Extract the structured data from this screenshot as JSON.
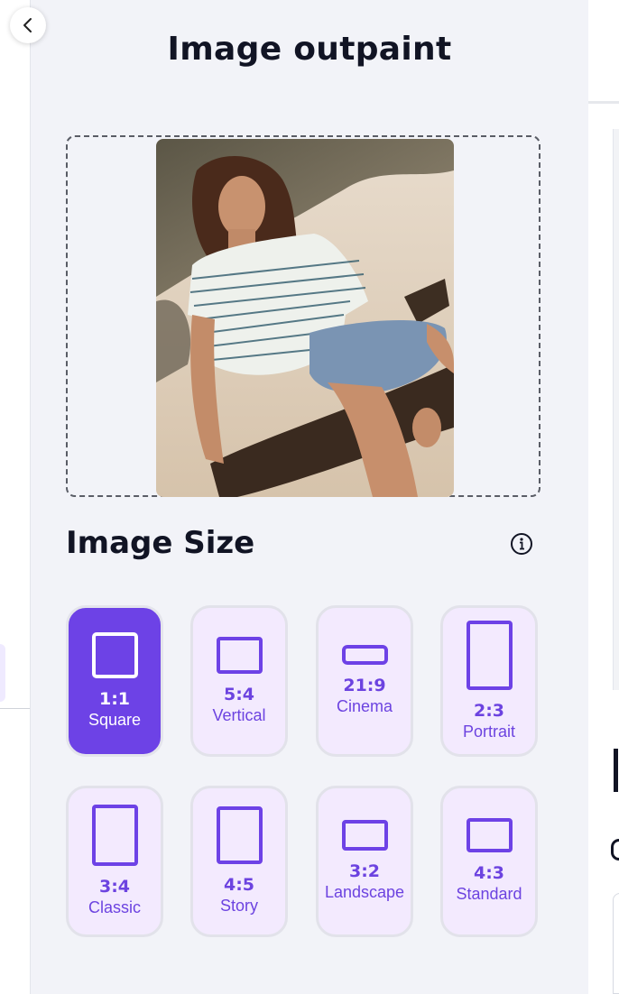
{
  "title": "Image outpaint",
  "image_size": {
    "heading": "Image Size",
    "options": [
      {
        "ratio": "1:1",
        "label": "Square",
        "selected": true
      },
      {
        "ratio": "5:4",
        "label": "Vertical",
        "selected": false
      },
      {
        "ratio": "21:9",
        "label": "Cinema",
        "selected": false
      },
      {
        "ratio": "2:3",
        "label": "Portrait",
        "selected": false
      },
      {
        "ratio": "3:4",
        "label": "Classic",
        "selected": false
      },
      {
        "ratio": "4:5",
        "label": "Story",
        "selected": false
      },
      {
        "ratio": "3:2",
        "label": "Landscape",
        "selected": false
      },
      {
        "ratio": "4:3",
        "label": "Standard",
        "selected": false
      }
    ]
  },
  "icons": {
    "back": "chevron-left-icon",
    "info": "info-icon"
  },
  "colors": {
    "accent": "#6d42e6",
    "card_bg": "#f3eafe",
    "panel_bg": "#f2f3f8",
    "text": "#111424"
  }
}
